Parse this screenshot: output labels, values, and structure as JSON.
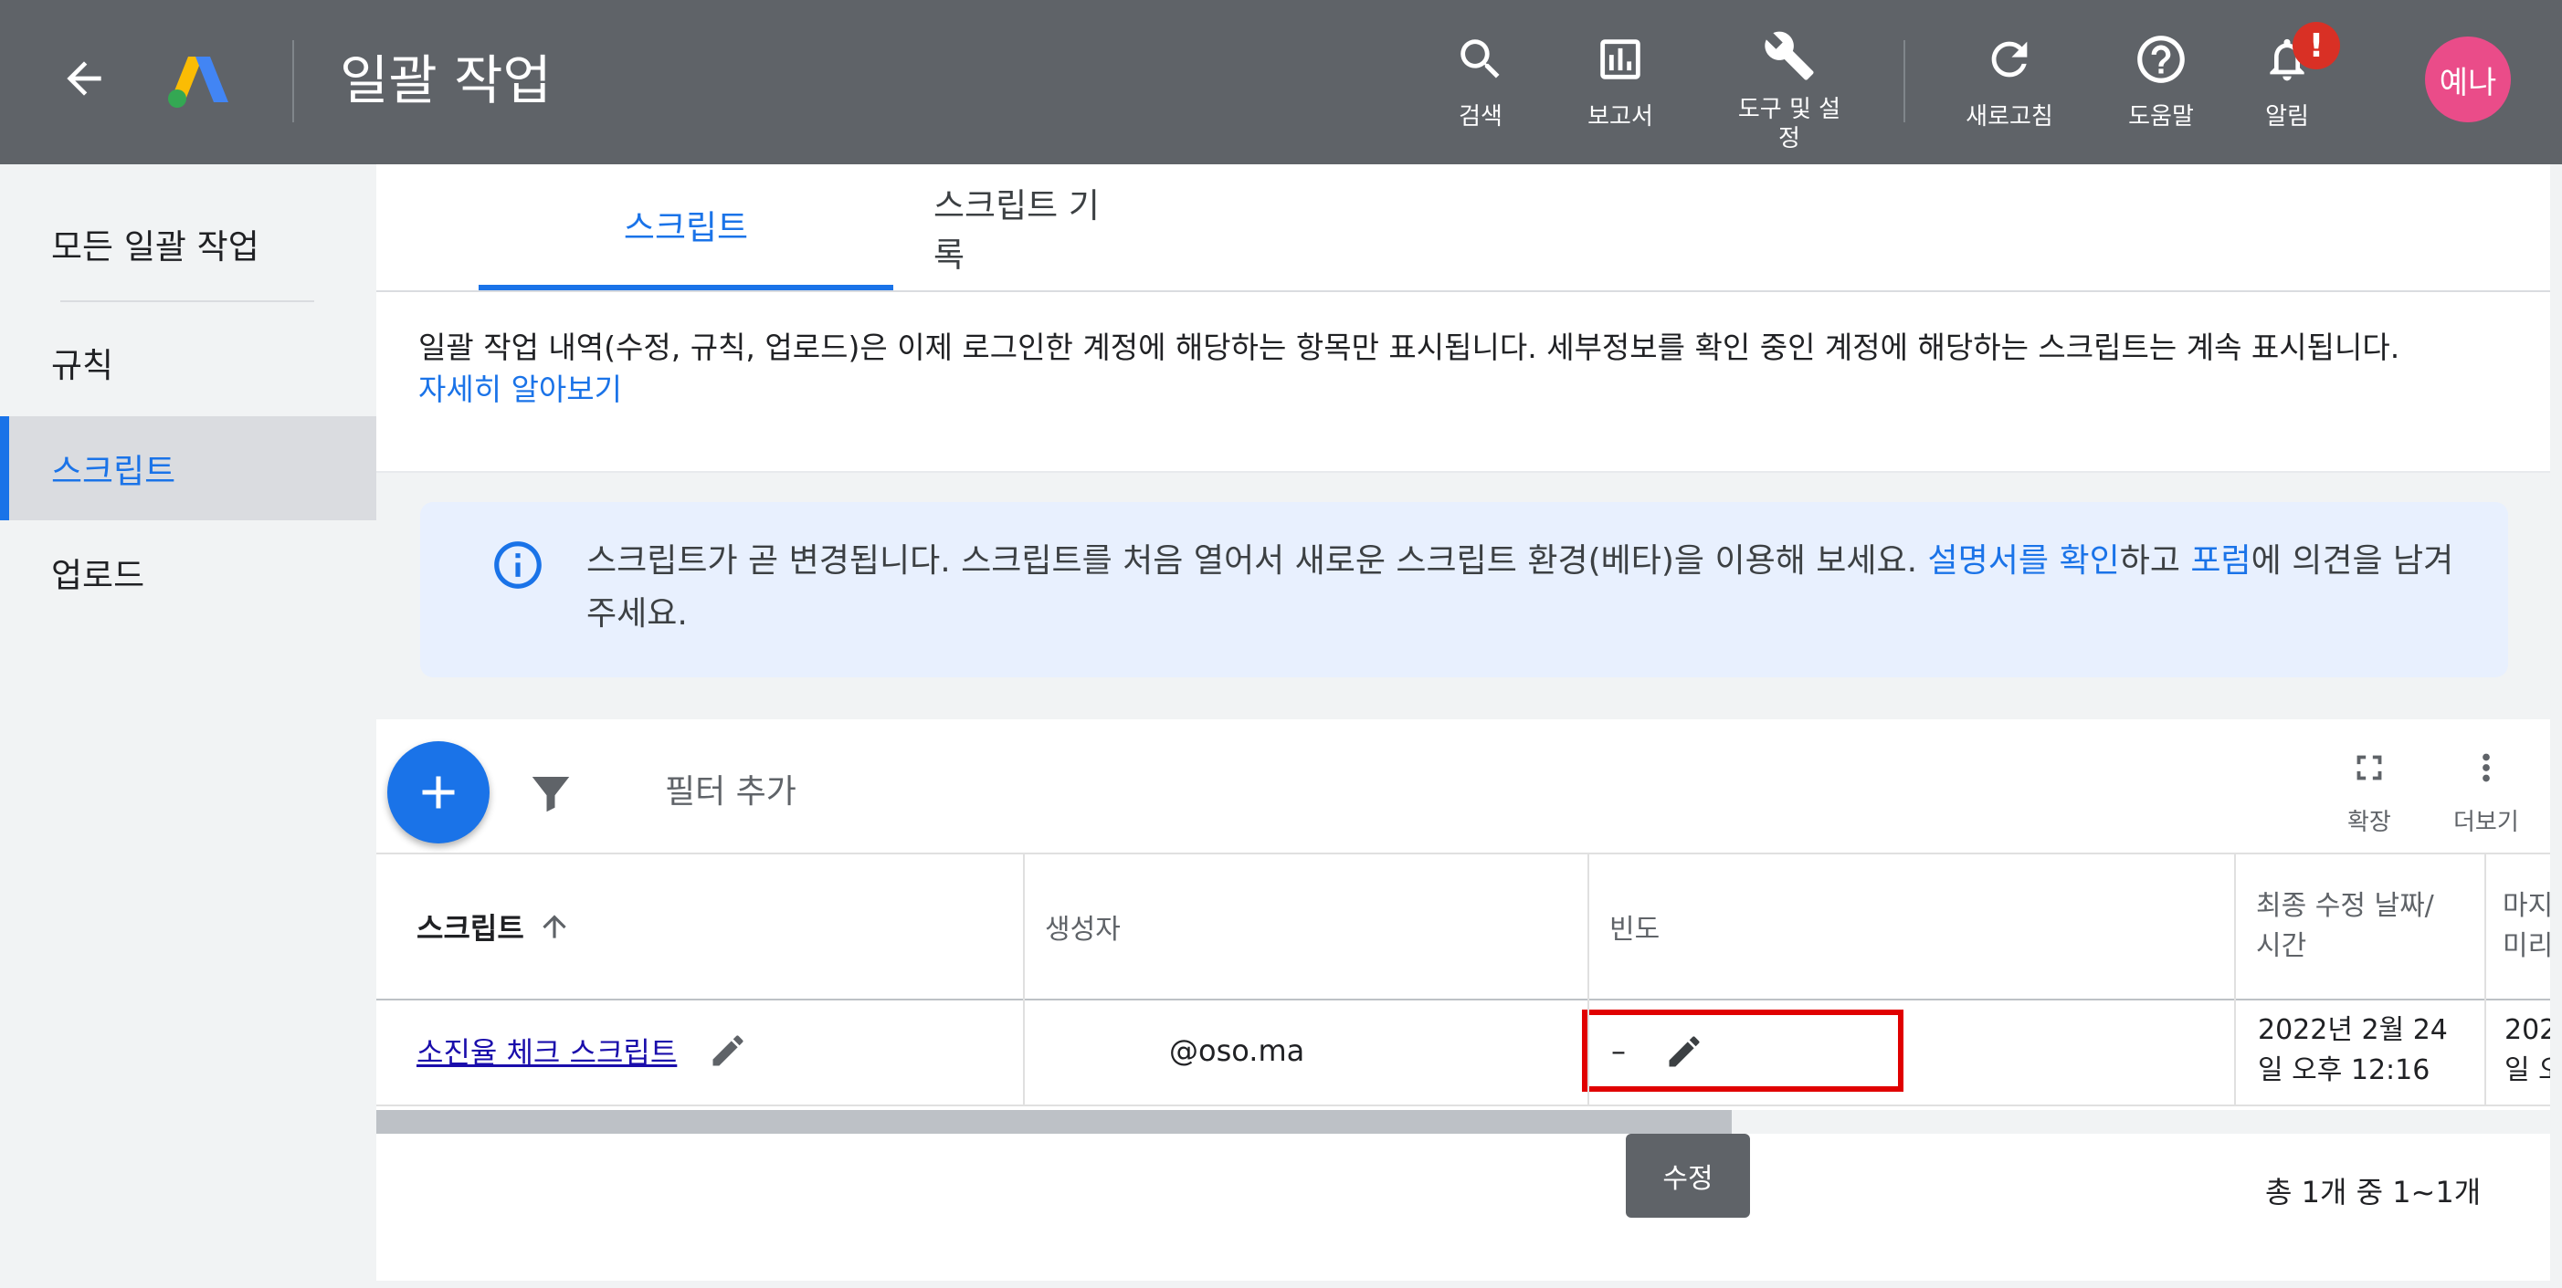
{
  "header": {
    "title": "일괄 작업",
    "buttons": [
      {
        "label": "검색",
        "icon": "search-icon"
      },
      {
        "label": "보고서",
        "icon": "report-icon"
      },
      {
        "label": "도구 및 설\n정",
        "icon": "wrench-icon"
      },
      {
        "label": "새로고침",
        "icon": "refresh-icon"
      },
      {
        "label": "도움말",
        "icon": "help-icon"
      },
      {
        "label": "알림",
        "icon": "bell-icon"
      }
    ],
    "notification_badge": "!",
    "avatar_text": "예나"
  },
  "sidebar": {
    "items": [
      {
        "label": "모든 일괄 작업"
      },
      {
        "label": "규칙"
      },
      {
        "label": "스크립트",
        "active": true
      },
      {
        "label": "업로드"
      }
    ]
  },
  "tabs": [
    {
      "label": "스크립트",
      "active": true
    },
    {
      "label": "스크립트 기록"
    }
  ],
  "notice": {
    "text": "일괄 작업 내역(수정, 규칙, 업로드)은 이제 로그인한 계정에 해당하는 항목만 표시됩니다. 세부정보를 확인 중인 계정에 해당하는 스크립트는 계속 표시됩니다.",
    "link": "자세히 알아보기"
  },
  "info": {
    "text1": "스크립트가 곧 변경됩니다. 스크립트를 처음 열어서 새로운 스크립트 환경(베타)을 이용해 보세요. ",
    "link1": "설명서를 확인",
    "text2": "하고 ",
    "link2": "포럼",
    "text3": "에 의견을 남겨 주세요."
  },
  "toolbar": {
    "filter_label": "필터 추가",
    "expand_label": "확장",
    "more_label": "더보기"
  },
  "table": {
    "columns": [
      "스크립트",
      "생성자",
      "빈도",
      "최종 수정 날짜/\n시간",
      "마지\n미리"
    ],
    "rows": [
      {
        "script": "소진율 체크 스크립트",
        "creator": "@oso.ma",
        "frequency": "–",
        "last_modified": "2022년 2월 24\n일 오후 12:16",
        "last_preview": "202\n일 오"
      }
    ],
    "tooltip": "수정",
    "pagination": "총 1개 중 1~1개"
  },
  "colors": {
    "header_bg": "#5f6368",
    "accent": "#1a73e8",
    "avatar_bg": "#ea4c89",
    "badge": "#d93025",
    "highlight": "#e00000"
  }
}
